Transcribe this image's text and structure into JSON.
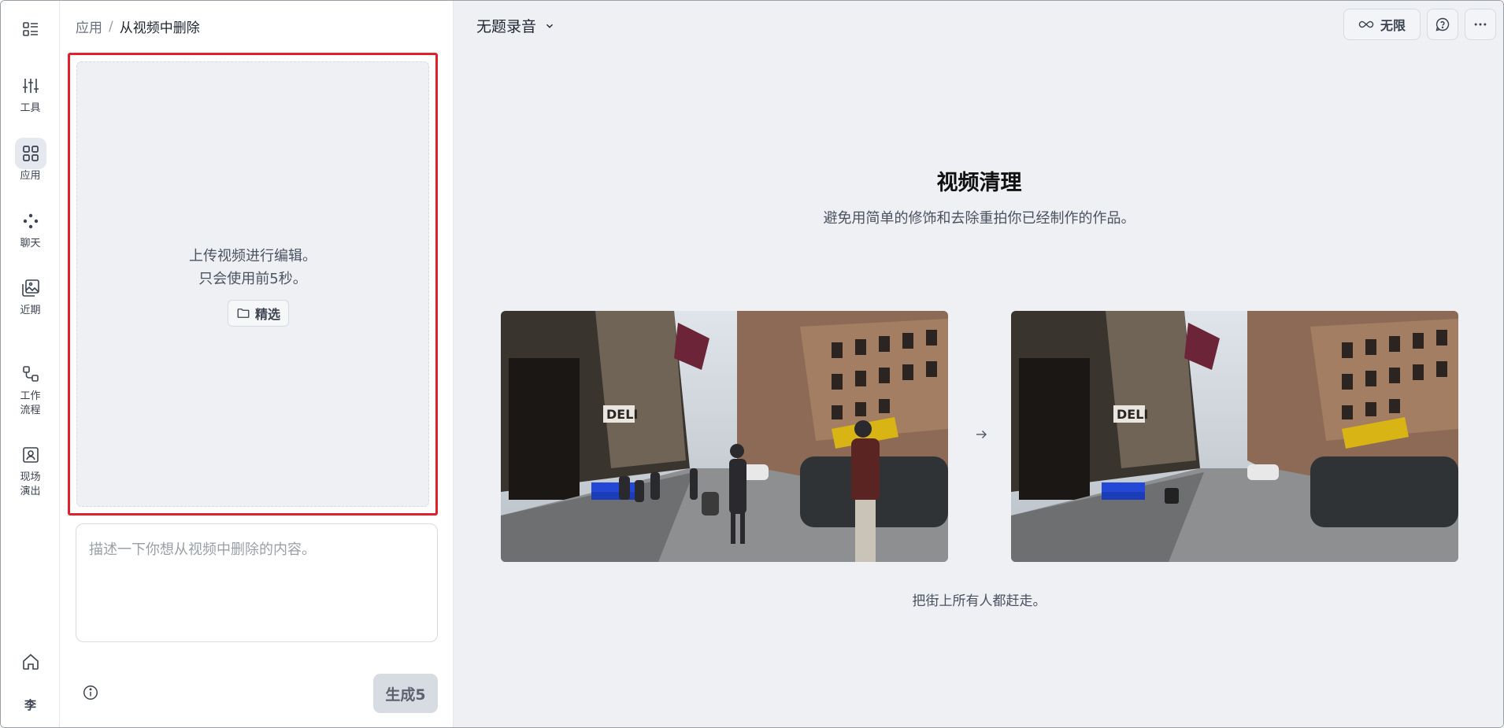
{
  "rail": {
    "items": [
      {
        "name": "menu",
        "label": ""
      },
      {
        "name": "tools",
        "label": "工具"
      },
      {
        "name": "apps",
        "label": "应用"
      },
      {
        "name": "chat",
        "label": "聊天"
      },
      {
        "name": "recent",
        "label": "近期"
      },
      {
        "name": "workflow",
        "label_line1": "工作",
        "label_line2": "流程"
      },
      {
        "name": "live",
        "label_line1": "现场",
        "label_line2": "演出"
      }
    ],
    "avatar": "李"
  },
  "breadcrumb": {
    "parent": "应用",
    "separator": "/",
    "current": "从视频中删除"
  },
  "upload": {
    "line1": "上传视频进行编辑。",
    "line2": "只会使用前5秒。",
    "pick_label": "精选"
  },
  "prompt": {
    "placeholder": "描述一下你想从视频中删除的内容。"
  },
  "generate": {
    "label": "生成5"
  },
  "header": {
    "recording_title": "无题录音",
    "unlimited_label": "无限"
  },
  "hero": {
    "title": "视频清理",
    "subtitle": "避免用简单的修饰和去除重拍你已经制作的作品。",
    "caption": "把街上所有人都赶走。"
  },
  "colors": {
    "accent_border": "#e0202a",
    "main_bg": "#eef0f4"
  }
}
